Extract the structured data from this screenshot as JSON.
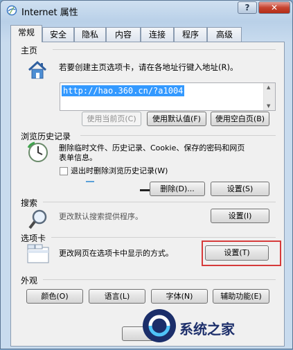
{
  "window": {
    "title": "Internet 属性",
    "help_label": "?",
    "close_label": "✕"
  },
  "tabs": [
    {
      "label": "常规",
      "active": true
    },
    {
      "label": "安全",
      "active": false
    },
    {
      "label": "隐私",
      "active": false
    },
    {
      "label": "内容",
      "active": false
    },
    {
      "label": "连接",
      "active": false
    },
    {
      "label": "程序",
      "active": false
    },
    {
      "label": "高级",
      "active": false
    }
  ],
  "homepage": {
    "group_label": "主页",
    "description": "若要创建主页选项卡，请在各地址行键入地址(R)。",
    "url": "http://hao.360.cn/?a1004",
    "use_current": "使用当前页(C)",
    "use_default": "使用默认值(F)",
    "use_blank": "使用空白页(B)"
  },
  "history": {
    "group_label": "浏览历史记录",
    "description_line1": "删除临时文件、历史记录、Cookie、保存的密码和网页",
    "description_line2": "表单信息。",
    "checkbox_label": "退出时删除浏览历史记录(W)",
    "delete_button": "删除(D)...",
    "settings_button": "设置(S)"
  },
  "search": {
    "group_label": "搜索",
    "description": "更改默认搜索提供程序。",
    "settings_button": "设置(I)"
  },
  "tabs_group": {
    "group_label": "选项卡",
    "description": "更改网页在选项卡中显示的方式。",
    "settings_button": "设置(T)"
  },
  "appearance": {
    "group_label": "外观",
    "colors": "颜色(O)",
    "languages": "语言(L)",
    "fonts": "字体(N)",
    "accessibility": "辅助功能(E)"
  },
  "watermark": {
    "text": "系统之家"
  },
  "colors": {
    "accent_red": "#d63a3a",
    "selection": "#3399ff"
  }
}
